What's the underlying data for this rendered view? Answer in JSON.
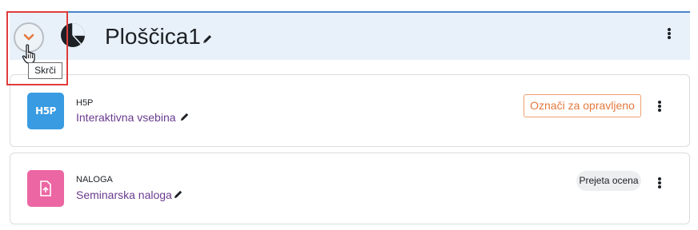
{
  "section": {
    "title": "Ploščica1",
    "tooltip": "Skrči"
  },
  "activities": [
    {
      "type": "H5P",
      "icon_text": "H5P",
      "name": "Interaktivna vsebina",
      "action_label": "Označi za opravljeno"
    },
    {
      "type": "NALOGA",
      "name": "Seminarska naloga",
      "status_label": "Prejeta ocena"
    }
  ],
  "colors": {
    "header_bg": "#e8f1fa",
    "accent_blue": "#4a85c7",
    "h5p_icon": "#399be2",
    "assignment_icon": "#eb66a2",
    "link_purple": "#6a3b8e",
    "completion_orange": "#e3793d",
    "highlight_red": "#e03c3c"
  },
  "icons": [
    "chevron-down-icon",
    "pie-chart-icon",
    "pencil-icon",
    "kebab-menu-icon",
    "h5p-icon",
    "assignment-upload-icon",
    "hand-cursor-icon"
  ]
}
